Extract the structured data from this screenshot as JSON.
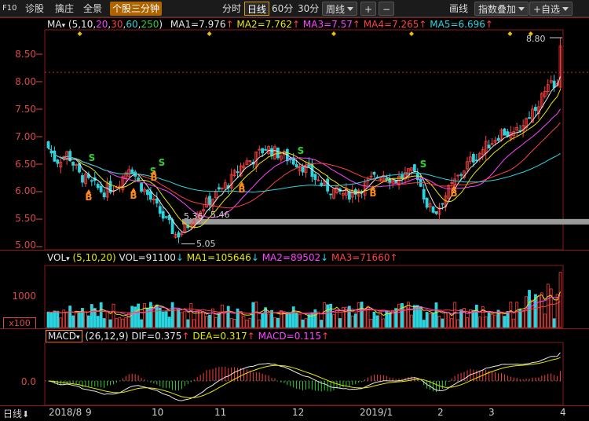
{
  "toolbar": {
    "f10": "F10",
    "diagnose": "诊股",
    "pick": "擒庄",
    "panorama": "全景",
    "active_tab": "个股三分钟",
    "periods": [
      "分时",
      "日线",
      "60分",
      "30分"
    ],
    "selected_period": "日线",
    "weekly": "周线",
    "plus": "+",
    "minus": "−",
    "draw": "画线",
    "overlay": "指数叠加",
    "watchlist": "+自选"
  },
  "ma_header": {
    "name": "MA",
    "params_prefix": "(5,10,",
    "params_20": "20",
    "params_comma1": ",",
    "params_30": "30",
    "params_comma2": ",",
    "params_60": "60",
    "params_comma3": ",",
    "params_250": "250",
    "params_suffix": ")",
    "ma1": "MA1=7.976",
    "ma2": "MA2=7.762",
    "ma3": "MA3=7.57",
    "ma4": "MA4=7.265",
    "ma5": "MA5=6.696"
  },
  "vol_header": {
    "name": "VOL",
    "params": "(5,10,20)",
    "vol": "VOL=91100",
    "ma1": "MA1=105646",
    "ma2": "MA2=89502",
    "ma3": "MA3=71660"
  },
  "macd_header": {
    "name": "MACD",
    "params": "(26,12,9)",
    "dif": "DIF=0.375",
    "dea": "DEA=0.317",
    "macd": "MACD=0.115"
  },
  "price_axis": [
    "8.50",
    "8.00",
    "7.50",
    "7.00",
    "6.50",
    "6.00",
    "5.50",
    "5.00"
  ],
  "vol_axis": {
    "top": "1000",
    "unit": "x100"
  },
  "macd_axis": "0.0",
  "annotations": {
    "high": "8.80",
    "low": "5.05",
    "low2_a": "5.36",
    "low2_b": "5.46"
  },
  "signals": {
    "sell": "S",
    "buy": "B"
  },
  "bottom": {
    "mode": "日线",
    "dates": [
      "2018/8",
      "9",
      "10",
      "11",
      "12",
      "2019/1",
      "2",
      "3",
      "4"
    ]
  },
  "colors": {
    "up": "#ff4040",
    "down": "#2ad5e0",
    "ma1": "#e6e6e6",
    "ma2": "#e8e800",
    "ma3": "#ff44ff",
    "ma4": "#ff4040",
    "ma5": "#2ad5e0",
    "active_tab": "#b06400"
  },
  "chart_data": {
    "type": "candlestick",
    "title": "",
    "ylim": [
      5.0,
      8.8
    ],
    "x": [
      "2018/8",
      "9",
      "10",
      "11",
      "12",
      "2019/1",
      "2",
      "3",
      "4"
    ],
    "series": [
      {
        "name": "MA1",
        "values": [
          6.7,
          6.3,
          6.2,
          5.7,
          6.5,
          6.2,
          6.0,
          6.3,
          7.976
        ]
      },
      {
        "name": "MA2",
        "values": [
          6.6,
          6.3,
          6.2,
          5.8,
          6.4,
          6.2,
          6.1,
          6.2,
          7.762
        ]
      },
      {
        "name": "MA3",
        "values": [
          6.5,
          6.4,
          6.3,
          5.9,
          6.3,
          6.2,
          6.1,
          6.2,
          7.57
        ]
      },
      {
        "name": "MA4",
        "values": [
          6.4,
          6.3,
          6.2,
          6.0,
          6.2,
          6.2,
          6.1,
          6.2,
          7.265
        ]
      },
      {
        "name": "MA5",
        "values": [
          6.2,
          6.2,
          6.1,
          6.1,
          6.1,
          6.1,
          6.1,
          6.2,
          6.696
        ]
      }
    ],
    "annotations": {
      "max": 8.8,
      "min": 5.05
    },
    "macd": {
      "DIF": 0.375,
      "DEA": 0.317,
      "MACD": 0.115
    },
    "volume": {
      "VOL": 91100,
      "MA1": 105646,
      "MA2": 89502,
      "MA3": 71660
    }
  }
}
